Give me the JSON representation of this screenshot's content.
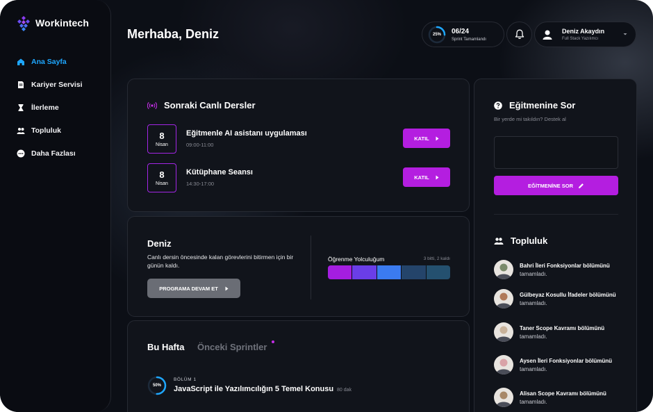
{
  "brand": {
    "name": "Workintech"
  },
  "sidebar": {
    "items": [
      {
        "label": "Ana Sayfa",
        "icon": "home-icon",
        "active": true
      },
      {
        "label": "Kariyer Servisi",
        "icon": "document-icon",
        "active": false
      },
      {
        "label": "İlerleme",
        "icon": "hourglass-icon",
        "active": false
      },
      {
        "label": "Topluluk",
        "icon": "people-icon",
        "active": false
      },
      {
        "label": "Daha Fazlası",
        "icon": "more-icon",
        "active": false
      }
    ]
  },
  "header": {
    "greeting": "Merhaba, Deniz",
    "sprint": {
      "percent_label": "25%",
      "progress": 0.25,
      "count": "06/24",
      "label": "Sprint Tamamlandı"
    },
    "user": {
      "name": "Deniz Akaydın",
      "role": "Full Stack Yazılımcı"
    }
  },
  "live_lessons": {
    "title": "Sonraki Canlı Dersler",
    "join_label": "KATIL",
    "items": [
      {
        "day": "8",
        "month": "Nisan",
        "name": "Eğitmenle AI asistanı uygulaması",
        "time": "09:00-11:00"
      },
      {
        "day": "8",
        "month": "Nisan",
        "name": "Kütüphane Seansı",
        "time": "14:30-17:00"
      }
    ]
  },
  "progress_card": {
    "name": "Deniz",
    "description": "Canlı dersin öncesinde kalan görevlerini bitirmen için bir günün kaldı.",
    "button": "PROGRAMA DEVAM ET",
    "journey_title": "Öğrenme Yolculuğum",
    "journey_meta": "3 bitti, 2 kaldı",
    "segments": [
      "#a41ee0",
      "#6a3ee8",
      "#3b7bf0",
      "#24446a",
      "#24506f"
    ]
  },
  "week": {
    "tab_active": "Bu Hafta",
    "tab_inactive": "Önceki Sprintler",
    "module": {
      "percent_label": "50%",
      "progress": 0.5,
      "chapter": "BÖLÜM 1",
      "name": "JavaScript ile Yazılımcılığın 5 Temel Konusu",
      "duration": "80 dak"
    }
  },
  "ask": {
    "title": "Eğitmenine Sor",
    "subtitle": "Bir yerde mi takıldın? Destek al",
    "button": "EĞİTMENİNE SOR"
  },
  "community": {
    "title": "Topluluk",
    "items": [
      {
        "bold": "Bahri İleri Fonksiyonlar bölümünü",
        "rest": " tamamladı.",
        "avatar_color": "#7a8a6a"
      },
      {
        "bold": "Gülbeyaz Kosullu İfadeler bölümünü",
        "rest": " tamamladı.",
        "avatar_color": "#b07a5a"
      },
      {
        "bold": "Taner Scope Kavramı bölümünü",
        "rest": " tamamladı.",
        "avatar_color": "#c8b29a"
      },
      {
        "bold": "Aysen İleri Fonksiyonlar bölümünü",
        "rest": " tamamladı.",
        "avatar_color": "#d9a3a8"
      },
      {
        "bold": "Alisan Scope Kavramı bölümünü",
        "rest": " tamamladı.",
        "avatar_color": "#a88868"
      }
    ]
  },
  "colors": {
    "accent": "#b41ee0",
    "active_nav": "#1ea7ff",
    "ring": "#1ea7ff"
  }
}
